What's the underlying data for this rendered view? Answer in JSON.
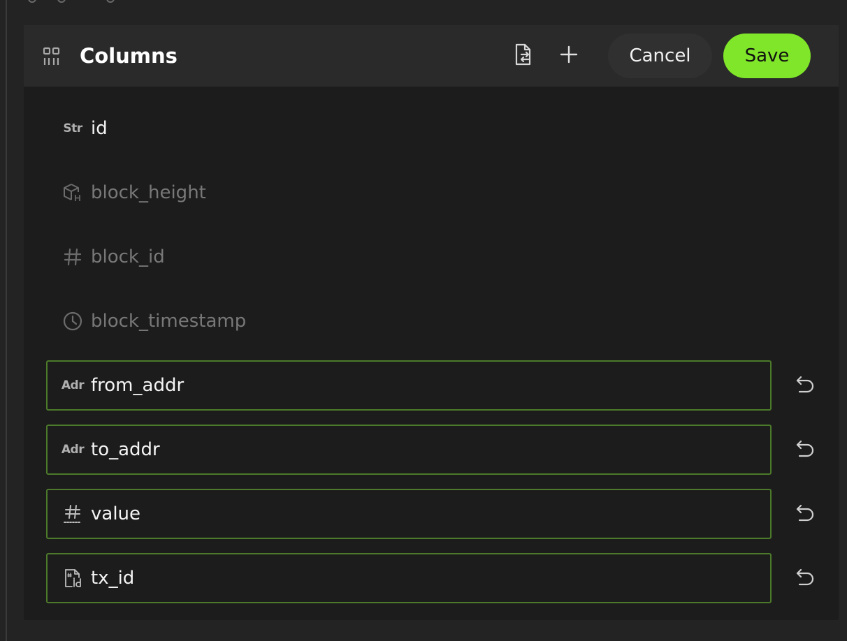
{
  "header": {
    "title": "Columns",
    "cancel_label": "Cancel",
    "save_label": "Save",
    "icons": [
      "grid-icon",
      "file-import-icon",
      "plus-icon"
    ]
  },
  "columns": [
    {
      "name": "id",
      "type_label": "Str",
      "icon": "string-type-icon",
      "state": "normal"
    },
    {
      "name": "block_height",
      "type_label": "",
      "icon": "block-height-icon",
      "state": "disabled"
    },
    {
      "name": "block_id",
      "type_label": "",
      "icon": "hash-icon",
      "state": "disabled"
    },
    {
      "name": "block_timestamp",
      "type_label": "",
      "icon": "clock-icon",
      "state": "disabled"
    },
    {
      "name": "from_addr",
      "type_label": "Adr",
      "icon": "address-type-icon",
      "state": "edited"
    },
    {
      "name": "to_addr",
      "type_label": "Adr",
      "icon": "address-type-icon",
      "state": "edited"
    },
    {
      "name": "value",
      "type_label": "",
      "icon": "number-type-icon",
      "state": "edited"
    },
    {
      "name": "tx_id",
      "type_label": "",
      "icon": "file-id-icon",
      "state": "edited"
    }
  ],
  "colors": {
    "accent": "#7fe629",
    "edited_border": "#4c7a2a",
    "panel_bg": "#1c1c1c",
    "header_bg": "#2a2a2a",
    "page_bg": "#232323"
  }
}
